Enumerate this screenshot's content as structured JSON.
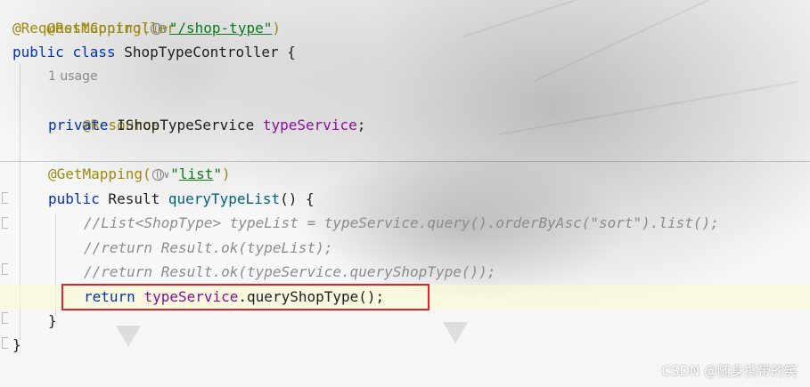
{
  "code": {
    "line0_annotation": "@RestController",
    "line1_annotation": "@RequestMapping(",
    "line1_string": "\"/shop-type\"",
    "line1_close": ")",
    "line2_public": "public",
    "line2_class": "class",
    "line2_name": " ShopTypeController {",
    "usage_hint": "1 usage",
    "line4_annotation": "@Resource",
    "line5_private": "private",
    "line5_type": " IShopTypeService ",
    "line5_field": "typeService",
    "line5_semicolon": ";",
    "line7_annotation": "@GetMapping(",
    "line7_string_q1": "\"",
    "line7_string_val": "list",
    "line7_string_q2": "\"",
    "line7_close": ")",
    "line8_public": "public",
    "line8_type": " Result ",
    "line8_method": "queryTypeList",
    "line8_rest": "() {",
    "comment1": "//List<ShopType> typeList = typeService.query().orderByAsc(\"sort\").list();",
    "comment2": "//return Result.ok(typeList);",
    "comment3": "//return Result.ok(typeService.queryShopType());",
    "return_kw": "return",
    "return_field": "typeService",
    "return_rest": ".queryShopType();",
    "close_method": "}",
    "close_class": "}"
  },
  "watermark": "CSDN @随身携带的笑",
  "colors": {
    "annotation": "#9e880d",
    "keyword": "#0033b3",
    "string": "#067d17",
    "field": "#871094",
    "method": "#00627a",
    "comment": "#8c8c8c",
    "highlight_box": "#e0242b"
  }
}
